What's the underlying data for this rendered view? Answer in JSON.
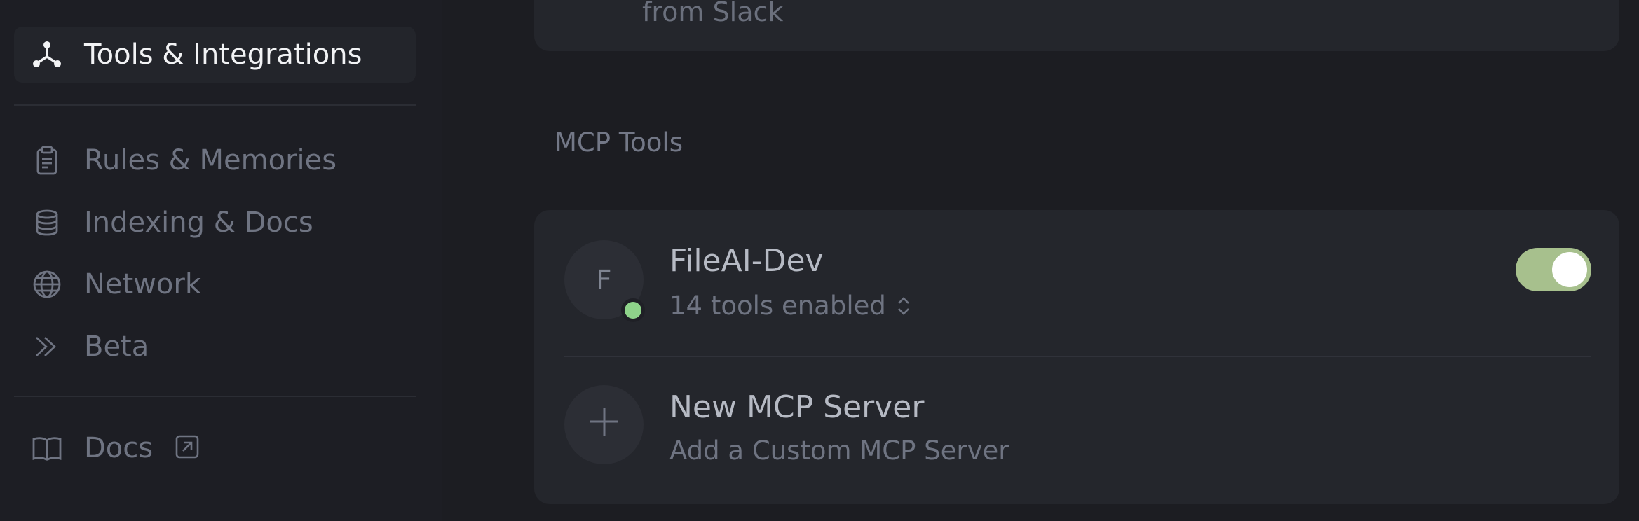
{
  "sidebar": {
    "active_item": {
      "label": "Tools & Integrations",
      "icon": "integration-nodes-icon"
    },
    "items": [
      {
        "label": "Rules & Memories",
        "icon": "clipboard-icon"
      },
      {
        "label": "Indexing & Docs",
        "icon": "database-icon"
      },
      {
        "label": "Network",
        "icon": "globe-icon"
      },
      {
        "label": "Beta",
        "icon": "double-chevron-right-icon"
      }
    ],
    "footer_item": {
      "label": "Docs",
      "icon": "book-icon",
      "external_icon": "external-link-icon"
    }
  },
  "main": {
    "partial_text": "from Slack",
    "section_title": "MCP Tools",
    "servers": [
      {
        "avatar_letter": "F",
        "name": "FileAI-Dev",
        "subtitle": "14 tools enabled",
        "status": "connected",
        "status_color": "#8ed38a",
        "enabled": true,
        "toggle_color": "#a7c08d"
      }
    ],
    "new_server": {
      "title": "New MCP Server",
      "subtitle": "Add a Custom MCP Server",
      "icon": "plus-icon"
    }
  }
}
